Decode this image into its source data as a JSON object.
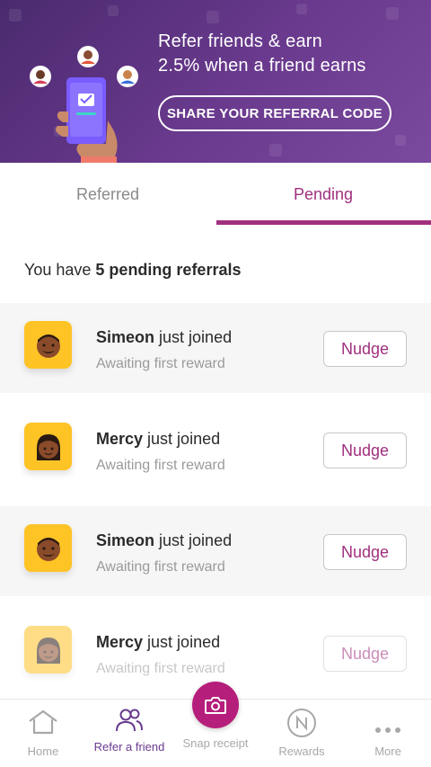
{
  "banner": {
    "title_line1": "Refer friends & earn",
    "title_line2": "2.5% when a friend earns",
    "share_button": "SHARE YOUR REFERRAL CODE"
  },
  "tabs": [
    {
      "label": "Referred",
      "active": false
    },
    {
      "label": "Pending",
      "active": true
    }
  ],
  "summary": {
    "prefix": "You have ",
    "count_text": "5 pending referrals"
  },
  "referrals": [
    {
      "name": "Simeon",
      "status": "just joined",
      "sub": "Awaiting first reward",
      "action": "Nudge",
      "avatar": "man-avatar-icon"
    },
    {
      "name": "Mercy",
      "status": "just joined",
      "sub": "Awaiting first reward",
      "action": "Nudge",
      "avatar": "woman-avatar-icon"
    },
    {
      "name": "Simeon",
      "status": "just joined",
      "sub": "Awaiting first reward",
      "action": "Nudge",
      "avatar": "man-avatar-icon"
    },
    {
      "name": "Mercy",
      "status": "just joined",
      "sub": "Awaiting first reward",
      "action": "Nudge",
      "avatar": "woman-avatar-icon"
    }
  ],
  "bottom_nav": [
    {
      "label": "Home",
      "icon": "home-icon"
    },
    {
      "label": "Refer a friend",
      "icon": "people-icon",
      "active": true
    },
    {
      "label": "Snap receipt",
      "icon": "camera-icon"
    },
    {
      "label": "Rewards",
      "icon": "rewards-coin-icon"
    },
    {
      "label": "More",
      "icon": "more-dots-icon"
    }
  ],
  "colors": {
    "brand_purple": "#6a3a8e",
    "accent_magenta": "#a0307e",
    "snap_button": "#b51e7a",
    "avatar_bg": "#fec325"
  }
}
